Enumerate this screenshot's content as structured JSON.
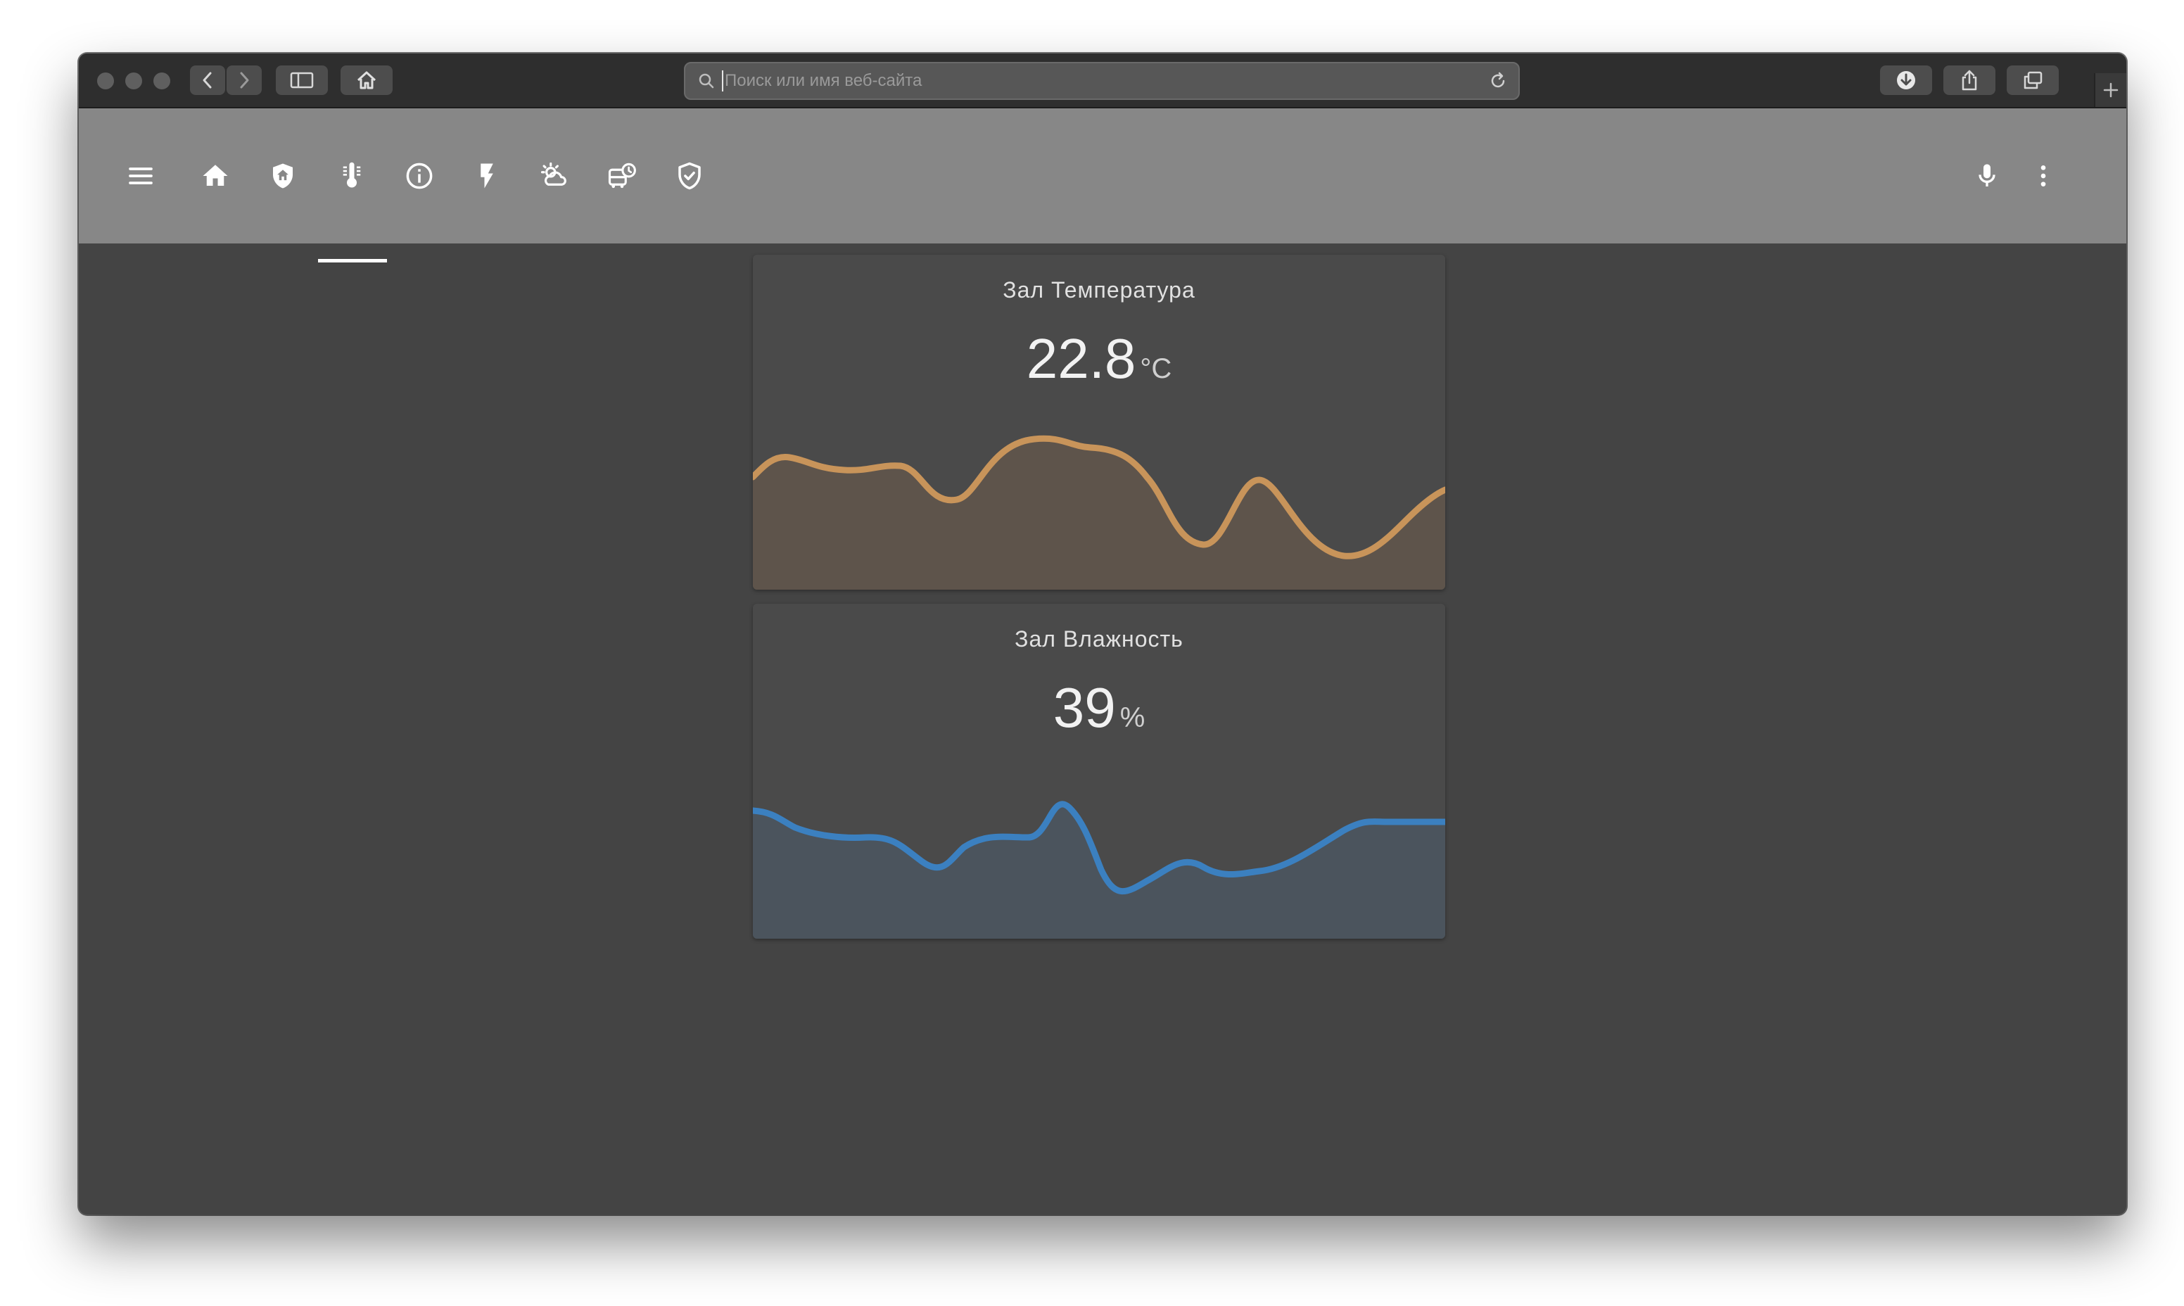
{
  "browser": {
    "address_placeholder": "Поиск или имя веб-сайта",
    "icons": [
      "close-dot",
      "minimize-dot",
      "zoom-dot",
      "chevron-left-icon",
      "chevron-right-icon",
      "sidebar-icon",
      "home-icon",
      "search-icon",
      "reload-icon",
      "download-icon",
      "share-icon",
      "tabs-icon",
      "plus-icon"
    ]
  },
  "app_header": {
    "icons": [
      "menu-icon",
      "home-icon",
      "shield-home-icon",
      "thermometer-icon",
      "info-icon",
      "flash-icon",
      "weather-partly-cloudy-icon",
      "bus-clock-icon",
      "shield-check-icon",
      "microphone-icon",
      "more-vert-icon"
    ],
    "active_tab": "thermometer-icon"
  },
  "cards": [
    {
      "title": "Зал Температура",
      "value": "22.8",
      "unit": "°C",
      "color": "#c8945a",
      "fill": "#5e544b"
    },
    {
      "title": "Зал Влажность",
      "value": "39",
      "unit": "%",
      "color": "#3b80c0",
      "fill": "#4b545d"
    }
  ],
  "colors": {
    "window_bg": "#444444",
    "header_bg": "#878787",
    "card_bg": "#4a4a4a"
  }
}
